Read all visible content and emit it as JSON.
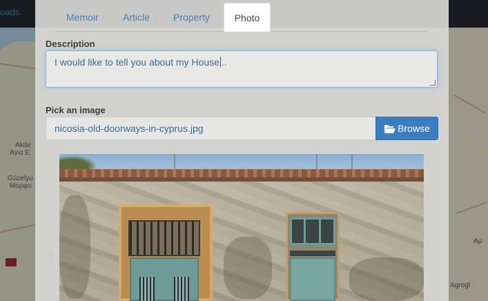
{
  "background": {
    "topbar_link": "oads",
    "map_labels": [
      "Akde",
      "Αγια Ε",
      "Güzelyu",
      "Μορφο",
      "Αμ",
      "Agrogl"
    ]
  },
  "modal": {
    "tabs": [
      {
        "label": "Memoir",
        "active": false
      },
      {
        "label": "Article",
        "active": false
      },
      {
        "label": "Property",
        "active": false
      },
      {
        "label": "Photo",
        "active": true
      }
    ],
    "description_label": "Description",
    "description_value_before_caret": "I would like to tell you about my House",
    "description_value_after_caret": "..",
    "pick_image_label": "Pick an image",
    "file_name": "nicosia-old-doorways-in-cyprus.jpg",
    "browse_label": "Browse",
    "browse_icon": "folder-open-icon",
    "accent_color": "#3a7ec0"
  }
}
